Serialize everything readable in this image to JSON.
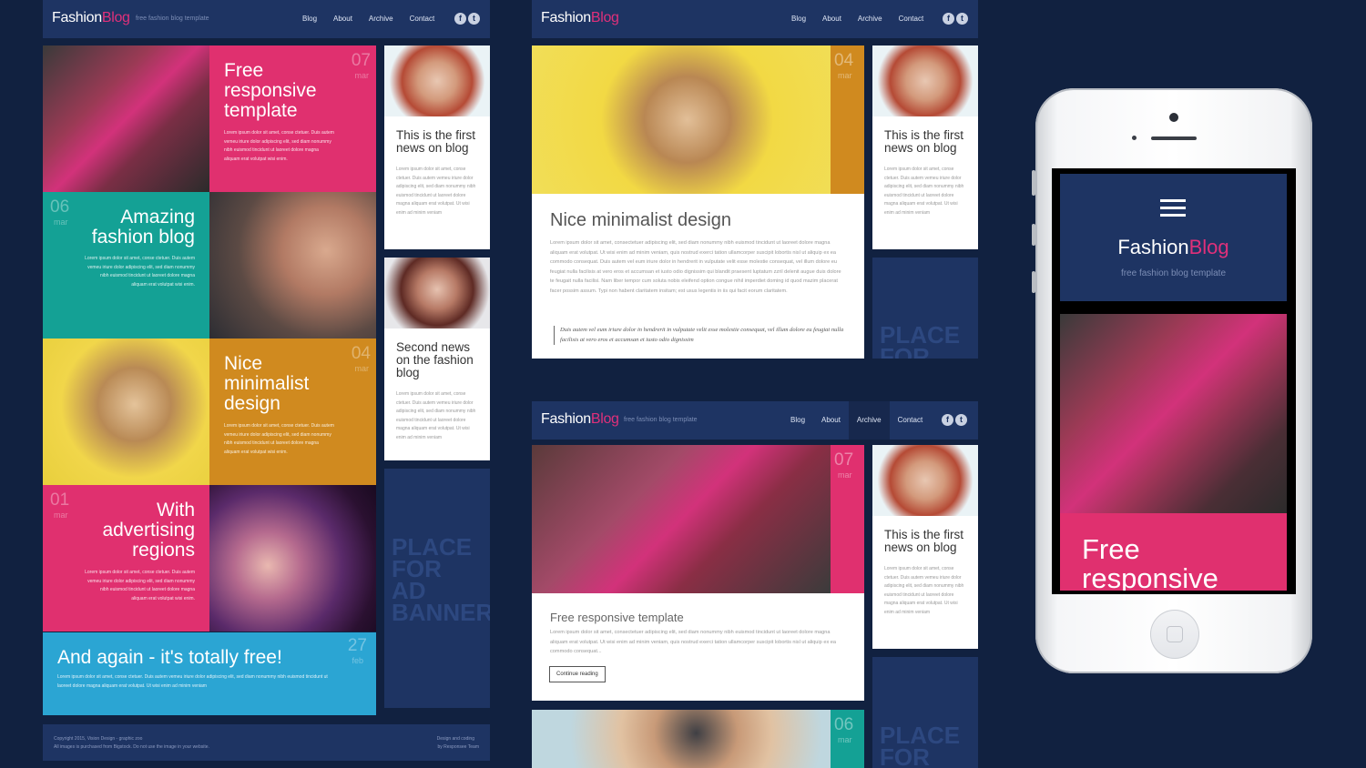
{
  "brand": {
    "fashion": "Fashion",
    "blog": "Blog",
    "tagline": "free fashion blog template"
  },
  "nav": [
    "Blog",
    "About",
    "Archive",
    "Contact"
  ],
  "social": {
    "facebook": "f",
    "twitter": "t"
  },
  "lorem_tile": "Lorem ipsum dolor sit amet, conse ctetuer. Duis autem vemeu iriure dolor adipiscing elit, sed diam nonummy nibh euismod tincidunt ut laoreet dolore magna aliquam erat volutpat wisi enim.",
  "lorem_card": "Lorem ipsum dolor sit amet, conse ctetuer. Duis autem vemeu iriure dolor adipiscing elit, sed diam nonummy nibh euismod tincidunt ut laoreet dolore magna aliquam erat volutpat. Ut wisi enim ad minim veniam",
  "tiles": [
    {
      "title": "Free responsive template",
      "day": "07",
      "month": "mar"
    },
    {
      "title": "Amazing fashion blog",
      "day": "06",
      "month": "mar"
    },
    {
      "title": "Nice minimalist design",
      "day": "04",
      "month": "mar"
    },
    {
      "title": "With advertising regions",
      "day": "01",
      "month": "mar"
    }
  ],
  "wide_tile": {
    "title": "And again - it's totally free!",
    "day": "27",
    "month": "feb",
    "body": "Lorem ipsum dolor sit amet, conse ctetuer. Duis autem vemeu iriure dolor adipiscing elit, sed diam nonummy nibh euismod tincidunt ut laoreet dolore magna aliquam erat volutpat. Ut wisi enim ad minim veniam"
  },
  "cards": [
    {
      "title": "This is the first news on blog"
    },
    {
      "title": "Second news on the fashion blog"
    }
  ],
  "ad_text": [
    "PLACE",
    "FOR",
    "AD",
    "BANNER"
  ],
  "footer": {
    "copyright": "Copyright 2015, Vision Design - graphic zoo",
    "images": "All images is purchased from Bigstock. Do not use the image in your website.",
    "design": "Design and coding",
    "by": "by Responsee Team"
  },
  "article": {
    "title": "Nice minimalist design",
    "day": "04",
    "month": "mar",
    "body": "Lorem ipsum dolor sit amet, consectetuer adipiscing elit, sed diam nonummy nibh euismod tincidunt ut laoreet dolore magna aliquam erat volutpat. Ut wisi enim ad minim veniam, quis nostrud exerci tation ullamcorper suscipit lobortis nisl ut aliquip ex ea commodo consequat. Duis autem vel eum iriure dolor in hendrerit in vulputate velit esse molestie consequat, vel illum dolore eu feugiat nulla facilisis at vero eros et accumsan et iusto odio dignissim qui blandit praesent luptatum zzril delenit augue duis dolore te feugait nulla facilisi. Nam liber tempor cum soluta nobis eleifend option congue nihil imperdiet doming id quod mazim placerat facer possim assum. Typi non habent claritatem insitam; est usus legentis in iis qui facit eorum claritatem.",
    "quote": "Duis autem vel eum iriure dolor in hendrerit in vulputate velit esse molestie consequat, vel illum dolore eu feugiat nulla facilisis at vero eros et accumsan et iusto odio dignissim"
  },
  "post": {
    "title": "Free responsive template",
    "day": "07",
    "month": "mar",
    "body": "Lorem ipsum dolor sit amet, consectetuer adipiscing elit, sed diam nonummy nibh euismod tincidunt ut laoreet dolore magna aliquam erat volutpat. Ut wisi enim ad minim veniam, quis nostrud exerci tation ullamcorper suscipit lobortis nisl ut aliquip ex ea commodo consequat...",
    "button": "Continue reading"
  },
  "post2": {
    "day": "06",
    "month": "mar"
  },
  "phone": {
    "title": "Free responsive"
  },
  "colors": {
    "navy": "#112140",
    "header": "#1e3463",
    "pink": "#e0306f",
    "teal": "#14a195",
    "orange": "#d08a1f",
    "blue": "#2ba5d3"
  }
}
